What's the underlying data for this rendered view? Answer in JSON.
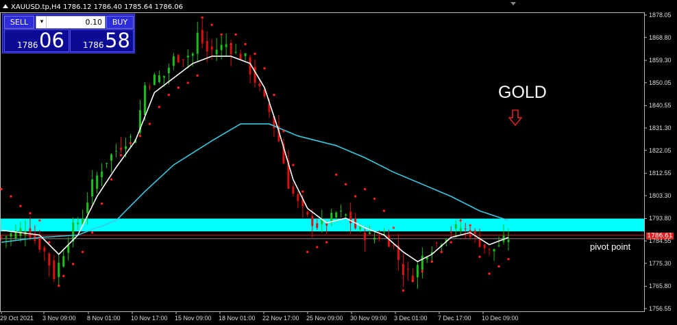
{
  "header": {
    "symbol": "XAUUSD.tp,H4",
    "ohlc": "1786.12 1786.40 1785.64 1786.06"
  },
  "trade_panel": {
    "sell_label": "SELL",
    "buy_label": "BUY",
    "lot": "0.10",
    "bid_prefix": "1786",
    "bid_big": "06",
    "ask_prefix": "1786",
    "ask_big": "58"
  },
  "annotations": {
    "gold": "GOLD",
    "pivot": "pivot point"
  },
  "price_tag": "1786.61",
  "y_axis": [
    "1878.05",
    "1868.80",
    "1859.30",
    "1850.05",
    "1840.55",
    "1831.30",
    "1822.05",
    "1812.55",
    "1803.30",
    "1793.80",
    "1784.55",
    "1775.30",
    "1765.80",
    "1756.55"
  ],
  "x_axis": [
    "29 Oct 2021",
    "3 Nov 09:00",
    "8 Nov 01:00",
    "10 Nov 17:00",
    "15 Nov 09:00",
    "18 Nov 01:00",
    "22 Nov 17:00",
    "25 Nov 09:00",
    "30 Nov 09:00",
    "3 Dec 01:00",
    "7 Dec 17:00",
    "10 Dec 09:00"
  ],
  "colors": {
    "bull": "#19c019",
    "bear": "#e01010",
    "sar": "#ff2020",
    "ma_fast": "#ffffff",
    "ma_slow": "#3cc8e0",
    "zone": "#00ffff",
    "line": "#d02020"
  },
  "chart_data": {
    "type": "candlestick",
    "ylim": [
      1756.55,
      1878.05
    ],
    "pivot_zone": [
      1788.5,
      1793.8
    ],
    "pivot_line": 1786.6,
    "trend": [
      [
        0,
        1786
      ],
      [
        3,
        1788
      ],
      [
        5,
        1790
      ],
      [
        7,
        1785
      ],
      [
        9,
        1780
      ],
      [
        11,
        1770
      ],
      [
        13,
        1780
      ],
      [
        15,
        1790
      ],
      [
        17,
        1795
      ],
      [
        19,
        1808
      ],
      [
        22,
        1818
      ],
      [
        24,
        1822
      ],
      [
        26,
        1826
      ],
      [
        28,
        1828
      ],
      [
        30,
        1849
      ],
      [
        32,
        1852
      ],
      [
        34,
        1853
      ],
      [
        36,
        1860
      ],
      [
        38,
        1861
      ],
      [
        40,
        1862
      ],
      [
        41,
        1870
      ],
      [
        43,
        1863
      ],
      [
        45,
        1864
      ],
      [
        47,
        1866
      ],
      [
        49,
        1862
      ],
      [
        51,
        1860
      ],
      [
        52,
        1855
      ],
      [
        54,
        1847
      ],
      [
        56,
        1838
      ],
      [
        58,
        1826
      ],
      [
        60,
        1808
      ],
      [
        62,
        1800
      ],
      [
        64,
        1794
      ],
      [
        66,
        1791
      ],
      [
        68,
        1792
      ],
      [
        70,
        1796
      ],
      [
        72,
        1795
      ],
      [
        74,
        1790
      ],
      [
        76,
        1787
      ],
      [
        78,
        1786
      ],
      [
        80,
        1787
      ],
      [
        82,
        1782
      ],
      [
        84,
        1772
      ],
      [
        86,
        1770
      ],
      [
        88,
        1778
      ],
      [
        90,
        1782
      ],
      [
        92,
        1785
      ],
      [
        94,
        1789
      ],
      [
        96,
        1790
      ],
      [
        98,
        1788
      ],
      [
        100,
        1784
      ],
      [
        102,
        1780
      ],
      [
        104,
        1783
      ],
      [
        106,
        1786
      ]
    ],
    "ma_fast": [
      [
        0,
        1789
      ],
      [
        8,
        1787
      ],
      [
        12,
        1779
      ],
      [
        16,
        1787
      ],
      [
        20,
        1803
      ],
      [
        24,
        1815
      ],
      [
        28,
        1826
      ],
      [
        32,
        1846
      ],
      [
        36,
        1852
      ],
      [
        40,
        1858
      ],
      [
        44,
        1861
      ],
      [
        48,
        1861
      ],
      [
        52,
        1858
      ],
      [
        55,
        1848
      ],
      [
        58,
        1830
      ],
      [
        61,
        1810
      ],
      [
        64,
        1798
      ],
      [
        68,
        1792
      ],
      [
        72,
        1794
      ],
      [
        76,
        1790
      ],
      [
        80,
        1787
      ],
      [
        84,
        1780
      ],
      [
        87,
        1776
      ],
      [
        90,
        1779
      ],
      [
        94,
        1786
      ],
      [
        98,
        1788
      ],
      [
        102,
        1783
      ],
      [
        106,
        1786
      ]
    ],
    "ma_slow": [
      [
        0,
        1784
      ],
      [
        8,
        1786
      ],
      [
        16,
        1787
      ],
      [
        24,
        1793
      ],
      [
        30,
        1805
      ],
      [
        36,
        1816
      ],
      [
        44,
        1826
      ],
      [
        50,
        1833
      ],
      [
        56,
        1833
      ],
      [
        62,
        1828
      ],
      [
        70,
        1824
      ],
      [
        76,
        1819
      ],
      [
        82,
        1813
      ],
      [
        88,
        1808
      ],
      [
        94,
        1803
      ],
      [
        100,
        1797
      ],
      [
        106,
        1793
      ]
    ],
    "sar": [
      [
        0,
        1806
      ],
      [
        2,
        1803
      ],
      [
        4,
        1799
      ],
      [
        6,
        1796
      ],
      [
        8,
        1793
      ],
      [
        10,
        1784
      ],
      [
        12,
        1766
      ],
      [
        13,
        1770
      ],
      [
        15,
        1775
      ],
      [
        17,
        1780
      ],
      [
        19,
        1788
      ],
      [
        21,
        1800
      ],
      [
        23,
        1810
      ],
      [
        25,
        1820
      ],
      [
        27,
        1825
      ],
      [
        29,
        1828
      ],
      [
        31,
        1833
      ],
      [
        33,
        1840
      ],
      [
        35,
        1845
      ],
      [
        37,
        1848
      ],
      [
        39,
        1850
      ],
      [
        41,
        1853
      ],
      [
        42,
        1877
      ],
      [
        44,
        1874
      ],
      [
        46,
        1870
      ],
      [
        48,
        1866
      ],
      [
        49,
        1870
      ],
      [
        51,
        1866
      ],
      [
        53,
        1862
      ],
      [
        55,
        1856
      ],
      [
        57,
        1845
      ],
      [
        59,
        1830
      ],
      [
        61,
        1816
      ],
      [
        63,
        1805
      ],
      [
        64,
        1780
      ],
      [
        66,
        1782
      ],
      [
        68,
        1784
      ],
      [
        70,
        1812
      ],
      [
        72,
        1808
      ],
      [
        74,
        1803
      ],
      [
        76,
        1806
      ],
      [
        78,
        1802
      ],
      [
        80,
        1797
      ],
      [
        82,
        1790
      ],
      [
        84,
        1764
      ],
      [
        86,
        1768
      ],
      [
        88,
        1772
      ],
      [
        90,
        1776
      ],
      [
        92,
        1780
      ],
      [
        94,
        1784
      ],
      [
        96,
        1793
      ],
      [
        98,
        1791
      ],
      [
        100,
        1778
      ],
      [
        102,
        1771
      ],
      [
        104,
        1774
      ],
      [
        106,
        1777
      ]
    ]
  }
}
